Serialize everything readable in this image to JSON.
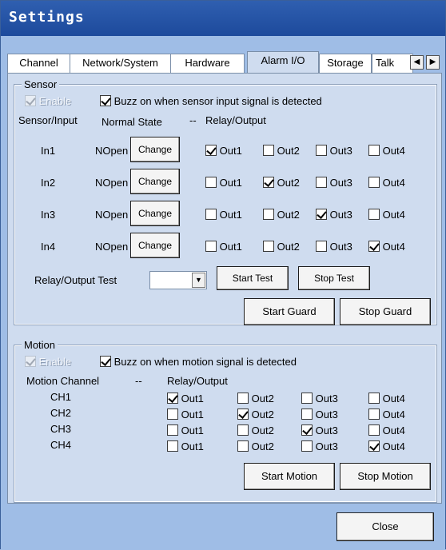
{
  "window": {
    "title": "Settings"
  },
  "tabs": [
    {
      "label": "Channel"
    },
    {
      "label": "Network/System"
    },
    {
      "label": "Hardware"
    },
    {
      "label": "Alarm I/O"
    },
    {
      "label": "Storage"
    },
    {
      "label": "Talk"
    }
  ],
  "sensor": {
    "legend": "Sensor",
    "enable_label": "Enable",
    "buzz_label": "Buzz on when sensor input signal is detected",
    "header_input": "Sensor/Input",
    "header_state": "Normal State",
    "header_sep": "--",
    "header_output": "Relay/Output",
    "change_label": "Change",
    "rows": [
      {
        "input": "In1",
        "state": "NOpen",
        "outputs": [
          true,
          false,
          false,
          false
        ]
      },
      {
        "input": "In2",
        "state": "NOpen",
        "outputs": [
          false,
          true,
          false,
          false
        ]
      },
      {
        "input": "In3",
        "state": "NOpen",
        "outputs": [
          false,
          false,
          true,
          false
        ]
      },
      {
        "input": "In4",
        "state": "NOpen",
        "outputs": [
          false,
          false,
          false,
          true
        ]
      }
    ],
    "output_labels": [
      "Out1",
      "Out2",
      "Out3",
      "Out4"
    ],
    "test_label": "Relay/Output Test",
    "test_select_value": "",
    "start_test": "Start Test",
    "stop_test": "Stop Test",
    "start_guard": "Start Guard",
    "stop_guard": "Stop Guard"
  },
  "motion": {
    "legend": "Motion",
    "enable_label": "Enable",
    "buzz_label": "Buzz on when motion signal is detected",
    "header_channel": "Motion Channel",
    "header_sep": "--",
    "header_output": "Relay/Output",
    "rows": [
      {
        "channel": "CH1",
        "outputs": [
          true,
          false,
          false,
          false
        ]
      },
      {
        "channel": "CH2",
        "outputs": [
          false,
          true,
          false,
          false
        ]
      },
      {
        "channel": "CH3",
        "outputs": [
          false,
          false,
          true,
          false
        ]
      },
      {
        "channel": "CH4",
        "outputs": [
          false,
          false,
          false,
          true
        ]
      }
    ],
    "output_labels": [
      "Out1",
      "Out2",
      "Out3",
      "Out4"
    ],
    "start_motion": "Start Motion",
    "stop_motion": "Stop Motion"
  },
  "close_label": "Close"
}
